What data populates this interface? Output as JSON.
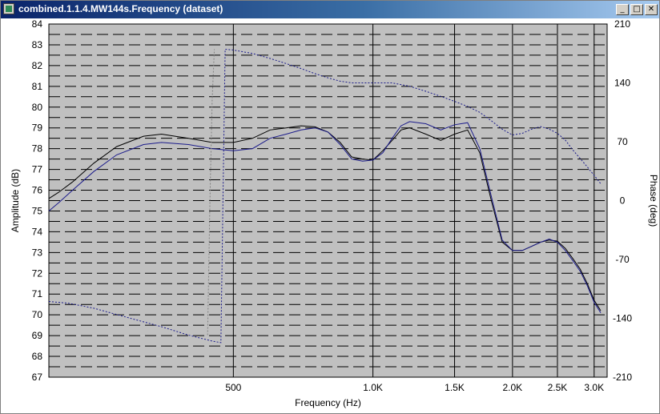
{
  "window": {
    "title": "combined.1.1.4.MW144s.Frequency (dataset)",
    "buttons": {
      "minimize": "_",
      "maximize": "□",
      "close": "✕"
    }
  },
  "chart_data": {
    "type": "line",
    "xlabel": "Frequency (Hz)",
    "ylabel_left": "Amplitude (dB)",
    "ylabel_right": "Phase (deg)",
    "xscale": "log",
    "xlim": [
      200,
      3200
    ],
    "ylim_left": [
      67,
      84
    ],
    "ylim_right": [
      -210,
      210
    ],
    "x_ticks": [
      {
        "value": 500,
        "label": "500"
      },
      {
        "value": 1000,
        "label": "1.0K"
      },
      {
        "value": 1500,
        "label": "1.5K"
      },
      {
        "value": 2000,
        "label": "2.0K"
      },
      {
        "value": 2500,
        "label": "2.5K"
      },
      {
        "value": 3000,
        "label": "3.0K"
      }
    ],
    "y_ticks_left": [
      "84",
      "83",
      "82",
      "81",
      "80",
      "79",
      "78",
      "77",
      "76",
      "75",
      "74",
      "73",
      "72",
      "71",
      "70",
      "69",
      "68",
      "67"
    ],
    "y_ticks_right": [
      {
        "value": 210,
        "label": "210"
      },
      {
        "value": 140,
        "label": "140"
      },
      {
        "value": 70,
        "label": "70"
      },
      {
        "value": 0,
        "label": "0"
      },
      {
        "value": -70,
        "label": "-70"
      },
      {
        "value": -140,
        "label": "-140"
      },
      {
        "value": -210,
        "label": "-210"
      }
    ],
    "grid": true,
    "colors": {
      "background": "#c0c0c0",
      "amplitude_black": "#000000",
      "amplitude_blue": "#1c1c8c",
      "phase_blue": "#1c1c8c",
      "phase_grey": "#808080"
    },
    "series": [
      {
        "axis": "left",
        "color": "#000000",
        "style": "solid",
        "x": [
          200,
          210,
          225,
          250,
          280,
          320,
          350,
          400,
          450,
          500,
          550,
          600,
          650,
          700,
          750,
          800,
          850,
          900,
          950,
          1000,
          1050,
          1100,
          1150,
          1200,
          1300,
          1400,
          1500,
          1600,
          1700,
          1800,
          1900,
          2000,
          2100,
          2200,
          2300,
          2400,
          2500,
          2600,
          2700,
          2800,
          2900,
          3000,
          3100
        ],
        "y": [
          75.6,
          75.9,
          76.4,
          77.3,
          78.1,
          78.6,
          78.7,
          78.5,
          78.3,
          78.3,
          78.5,
          78.9,
          79.0,
          79.1,
          79.05,
          78.8,
          78.3,
          77.6,
          77.5,
          77.45,
          77.9,
          78.4,
          78.9,
          79.0,
          78.7,
          78.4,
          78.7,
          78.9,
          77.8,
          75.5,
          73.5,
          73.1,
          73.1,
          73.3,
          73.5,
          73.6,
          73.55,
          73.2,
          72.7,
          72.2,
          71.5,
          70.7,
          70.2
        ]
      },
      {
        "axis": "left",
        "color": "#1c1c8c",
        "style": "solid",
        "x": [
          200,
          210,
          225,
          250,
          280,
          320,
          350,
          400,
          450,
          500,
          550,
          600,
          650,
          700,
          750,
          800,
          850,
          900,
          950,
          1000,
          1050,
          1100,
          1150,
          1200,
          1300,
          1400,
          1500,
          1600,
          1700,
          1800,
          1900,
          2000,
          2100,
          2200,
          2300,
          2400,
          2500,
          2600,
          2700,
          2800,
          2900,
          3000,
          3100
        ],
        "y": [
          75.0,
          75.4,
          76.0,
          76.9,
          77.7,
          78.2,
          78.3,
          78.2,
          78.0,
          77.9,
          78.0,
          78.5,
          78.7,
          78.9,
          79.0,
          78.8,
          78.2,
          77.5,
          77.4,
          77.45,
          77.8,
          78.5,
          79.1,
          79.3,
          79.2,
          78.9,
          79.15,
          79.25,
          78.0,
          75.7,
          73.6,
          73.1,
          73.1,
          73.3,
          73.5,
          73.65,
          73.5,
          73.1,
          72.6,
          72.1,
          71.4,
          70.6,
          70.1
        ]
      },
      {
        "axis": "right",
        "color": "#1c1c8c",
        "style": "dotted",
        "x": [
          200,
          220,
          250,
          300,
          350,
          400,
          450,
          470,
          480,
          500,
          550,
          600,
          650,
          700,
          750,
          800,
          850,
          900,
          950,
          1000,
          1100,
          1200,
          1300,
          1400,
          1500,
          1600,
          1700,
          1800,
          1900,
          2000,
          2100,
          2200,
          2300,
          2400,
          2500,
          2600,
          2700,
          2800,
          2900,
          3000,
          3100
        ],
        "y": [
          -120,
          -122,
          -128,
          -140,
          -150,
          -160,
          -167,
          -169,
          180,
          179,
          175,
          169,
          163,
          157,
          151,
          146,
          142,
          140,
          140,
          140,
          140,
          136,
          130,
          124,
          118,
          112,
          105,
          95,
          85,
          78,
          80,
          85,
          88,
          85,
          80,
          72,
          60,
          50,
          40,
          30,
          20
        ]
      },
      {
        "axis": "right",
        "color": "#808080",
        "style": "dotted",
        "x": [
          440,
          445,
          450,
          455
        ],
        "y": [
          -160,
          0,
          120,
          180
        ]
      }
    ]
  }
}
